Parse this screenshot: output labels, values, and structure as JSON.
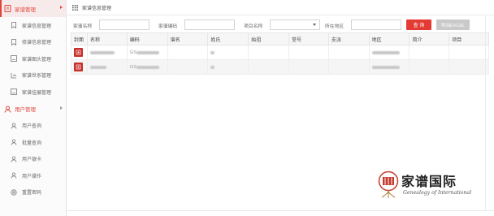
{
  "sidebar": {
    "group1": {
      "label": "家谱管理",
      "icon": "book-icon"
    },
    "items1": [
      {
        "label": "家谱信息管理",
        "icon": "bookmark-icon"
      },
      {
        "label": "修谱信息管理",
        "icon": "bookmark-icon"
      },
      {
        "label": "家谱图头管理",
        "icon": "image-icon"
      },
      {
        "label": "家谱世系管理",
        "icon": "tree-icon"
      },
      {
        "label": "家谱挂展管理",
        "icon": "image-icon"
      }
    ],
    "group2": {
      "label": "用户管理",
      "icon": "user-icon"
    },
    "items2": [
      {
        "label": "用户查询",
        "icon": "user-icon"
      },
      {
        "label": "批量查询",
        "icon": "user-icon"
      },
      {
        "label": "用户银卡",
        "icon": "user-icon"
      },
      {
        "label": "用户操作",
        "icon": "user-icon"
      },
      {
        "label": "重置密码",
        "icon": "gear-icon"
      }
    ]
  },
  "topbar": {
    "title": "家谱信息管理",
    "icon": "grid-icon"
  },
  "filters": {
    "name_label": "家谱名称",
    "code_label": "家谱编码",
    "project_label": "项目名称",
    "region_label": "所在地区",
    "search_button": "查 询",
    "export_button": "导出EXCEL"
  },
  "table": {
    "headers": [
      "封面",
      "名称",
      "编码",
      "谱名",
      "姓氏",
      "始祖",
      "堂号",
      "支派",
      "地区",
      "简介",
      "项目"
    ],
    "rows": [
      {
        "code": "GS"
      },
      {
        "code": "GS"
      }
    ]
  },
  "logo": {
    "cn": "家谱国际",
    "en": "Genealogy of International",
    "icon": "roots-logo-icon"
  },
  "colors": {
    "accent": "#e33b33",
    "export": "#c9c9c9"
  }
}
